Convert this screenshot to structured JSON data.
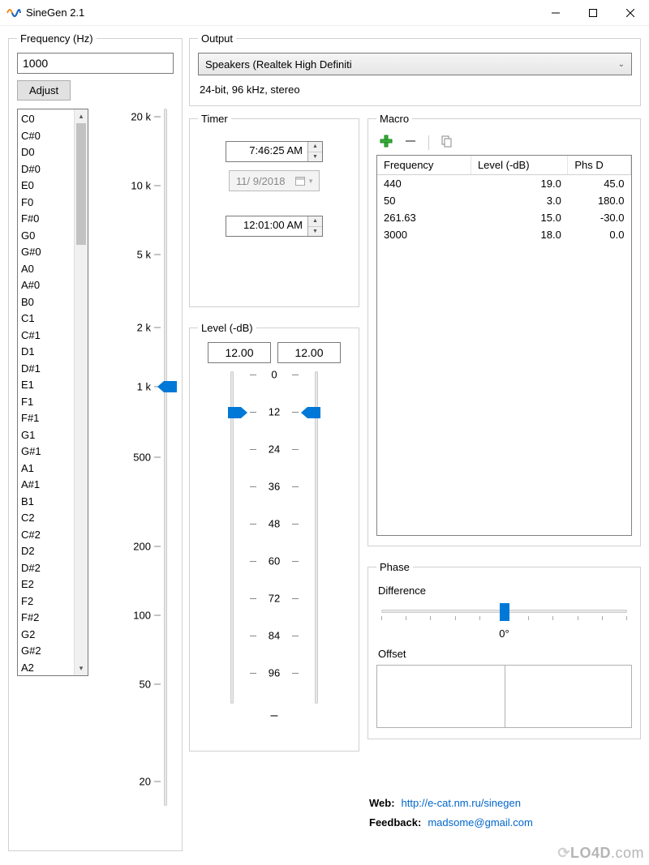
{
  "window": {
    "title": "SineGen 2.1"
  },
  "frequency": {
    "legend": "Frequency (Hz)",
    "value": "1000",
    "adjust_label": "Adjust",
    "scale_labels": [
      "20 k",
      "10 k",
      "5 k",
      "2 k",
      "1 k",
      "500",
      "200",
      "100",
      "50",
      "20"
    ],
    "notes": [
      "C0",
      "C#0",
      "D0",
      "D#0",
      "E0",
      "F0",
      "F#0",
      "G0",
      "G#0",
      "A0",
      "A#0",
      "B0",
      "C1",
      "C#1",
      "D1",
      "D#1",
      "E1",
      "F1",
      "F#1",
      "G1",
      "G#1",
      "A1",
      "A#1",
      "B1",
      "C2",
      "C#2",
      "D2",
      "D#2",
      "E2",
      "F2",
      "F#2",
      "G2",
      "G#2",
      "A2"
    ]
  },
  "output": {
    "legend": "Output",
    "device": "Speakers (Realtek High Definiti",
    "info": "24-bit, 96 kHz, stereo"
  },
  "timer": {
    "legend": "Timer",
    "time1": "7:46:25 AM",
    "date": "11/  9/2018",
    "time2": "12:01:00 AM"
  },
  "level": {
    "legend": "Level (-dB)",
    "left_value": "12.00",
    "right_value": "12.00",
    "scale": [
      "0",
      "12",
      "24",
      "36",
      "48",
      "60",
      "72",
      "84",
      "96"
    ],
    "dash": "–"
  },
  "macro": {
    "legend": "Macro",
    "headers": [
      "Frequency",
      "Level (-dB)",
      "Phs D"
    ],
    "rows": [
      {
        "freq": "440",
        "level": "19.0",
        "phs": "45.0"
      },
      {
        "freq": "50",
        "level": "3.0",
        "phs": "180.0"
      },
      {
        "freq": "261.63",
        "level": "15.0",
        "phs": "-30.0"
      },
      {
        "freq": "3000",
        "level": "18.0",
        "phs": "0.0"
      }
    ]
  },
  "phase": {
    "legend": "Phase",
    "difference_label": "Difference",
    "value": "0°",
    "offset_label": "Offset"
  },
  "footer": {
    "web_label": "Web:",
    "web_url": "http://e-cat.nm.ru/sinegen",
    "feedback_label": "Feedback:",
    "feedback_email": "madsome@gmail.com"
  },
  "watermark": "LO4D.com"
}
